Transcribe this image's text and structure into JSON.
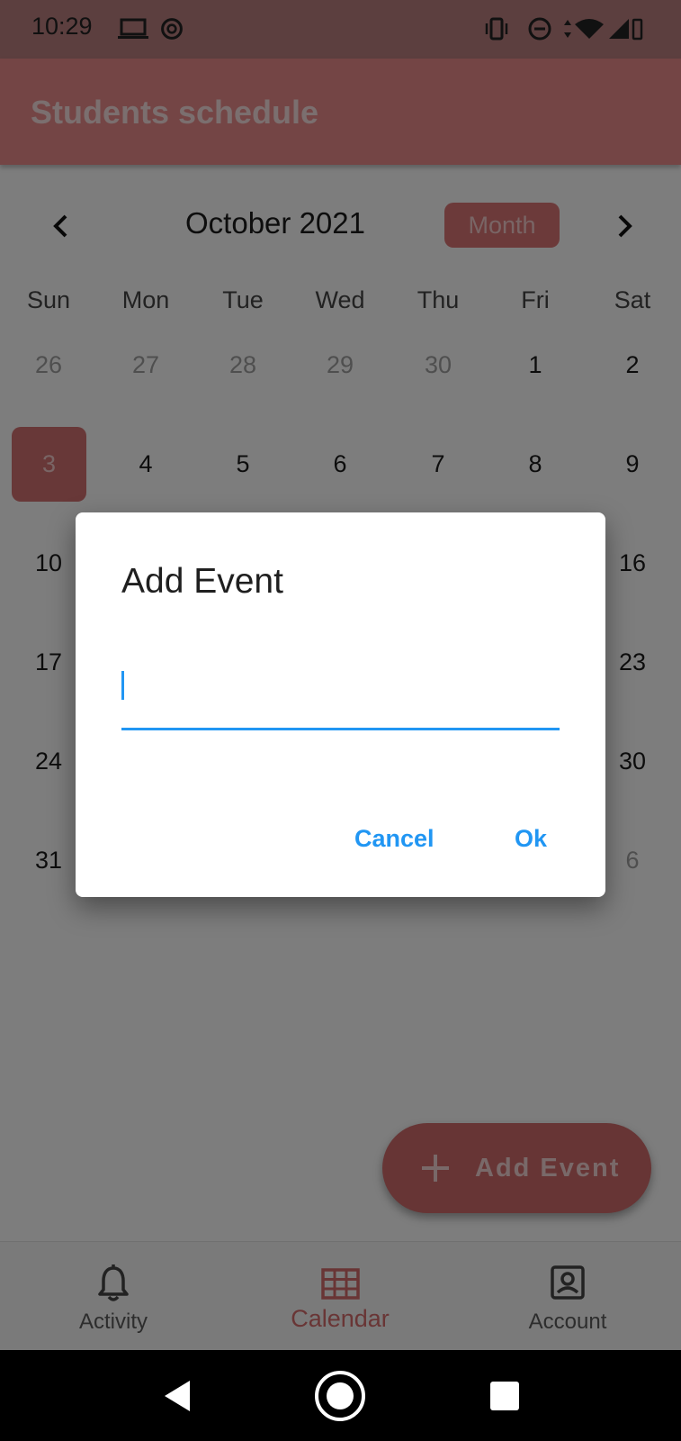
{
  "status_bar": {
    "time": "10:29"
  },
  "app_bar": {
    "title": "Students schedule"
  },
  "calendar": {
    "month_label": "October 2021",
    "view_button": "Month",
    "weekdays": [
      "Sun",
      "Mon",
      "Tue",
      "Wed",
      "Thu",
      "Fri",
      "Sat"
    ],
    "weeks": [
      [
        "26",
        "27",
        "28",
        "29",
        "30",
        "1",
        "2"
      ],
      [
        "3",
        "4",
        "5",
        "6",
        "7",
        "8",
        "9"
      ],
      [
        "10",
        "",
        "",
        "",
        "",
        "",
        "16"
      ],
      [
        "17",
        "",
        "",
        "",
        "",
        "",
        "23"
      ],
      [
        "24",
        "",
        "",
        "",
        "",
        "",
        "30"
      ],
      [
        "31",
        "",
        "",
        "",
        "",
        "",
        "6"
      ]
    ],
    "selected_day": "3",
    "accent_color": "#d17070"
  },
  "fab": {
    "label": "Add Event"
  },
  "bottom_nav": {
    "items": [
      {
        "label": "Activity",
        "icon": "bell-icon"
      },
      {
        "label": "Calendar",
        "icon": "grid-calendar-icon",
        "active": true
      },
      {
        "label": "Account",
        "icon": "account-box-icon"
      }
    ]
  },
  "dialog": {
    "title": "Add Event",
    "input_value": "",
    "cancel_label": "Cancel",
    "ok_label": "Ok",
    "accent_color": "#2196f3"
  }
}
